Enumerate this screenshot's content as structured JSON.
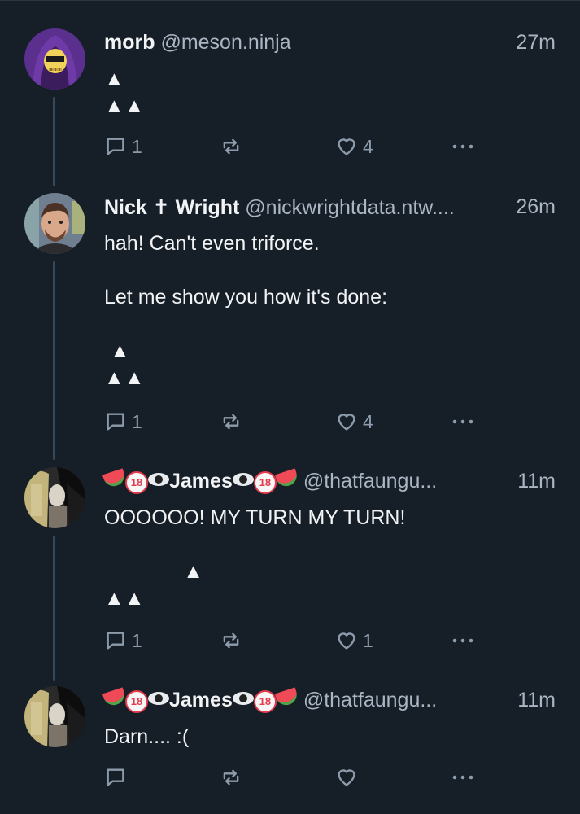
{
  "posts": [
    {
      "display_name": "morb",
      "handle": "@meson.ninja",
      "time": "27m",
      "body": "▲\n▲▲",
      "reply_count": "1",
      "like_count": "4"
    },
    {
      "display_name": "Nick ✝ Wright",
      "handle": "@nickwrightdata.ntw....",
      "time": "26m",
      "body": "hah! Can't even triforce.\n\nLet me show you how it's done:\n\n ▲\n▲▲",
      "reply_count": "1",
      "like_count": "4"
    },
    {
      "display_name_text": "James",
      "handle": "@thatfaungu...",
      "time": "11m",
      "body": "OOOOOO! MY TURN MY TURN!\n\n              ▲\n▲▲",
      "reply_count": "1",
      "like_count": "1"
    },
    {
      "display_name_text": "James",
      "handle": "@thatfaungu...",
      "time": "11m",
      "body": "Darn.... :(",
      "reply_count": "",
      "like_count": ""
    }
  ],
  "badge_text": "18",
  "icons": {
    "reply": "speech-bubble-icon",
    "repost": "repost-arrows-icon",
    "like": "heart-outline-icon",
    "more": "ellipsis-icon"
  },
  "colors": {
    "background": "#161e27",
    "muted": "#aab6c3",
    "thread_line": "#35495b"
  }
}
